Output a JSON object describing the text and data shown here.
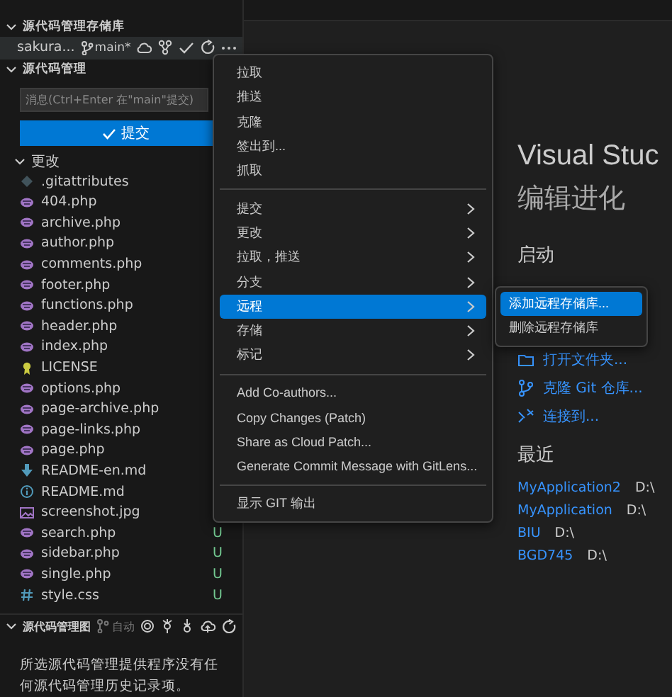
{
  "sidebar": {
    "repos_header": "源代码管理存储库",
    "repo": {
      "name": "sakura...",
      "branch": "main*"
    },
    "scm_header": "源代码管理",
    "message": {
      "placeholder": "消息(Ctrl+Enter 在\"main\"提交)"
    },
    "commit_button": "提交",
    "changes_header": "更改",
    "files": [
      {
        "name": ".gitattributes",
        "kind": "git"
      },
      {
        "name": "404.php",
        "kind": "php"
      },
      {
        "name": "archive.php",
        "kind": "php"
      },
      {
        "name": "author.php",
        "kind": "php"
      },
      {
        "name": "comments.php",
        "kind": "php"
      },
      {
        "name": "footer.php",
        "kind": "php"
      },
      {
        "name": "functions.php",
        "kind": "php"
      },
      {
        "name": "header.php",
        "kind": "php"
      },
      {
        "name": "index.php",
        "kind": "php"
      },
      {
        "name": "LICENSE",
        "kind": "license"
      },
      {
        "name": "options.php",
        "kind": "php"
      },
      {
        "name": "page-archive.php",
        "kind": "php"
      },
      {
        "name": "page-links.php",
        "kind": "php"
      },
      {
        "name": "page.php",
        "kind": "php"
      },
      {
        "name": "README-en.md",
        "kind": "mddown"
      },
      {
        "name": "README.md",
        "kind": "info"
      },
      {
        "name": "screenshot.jpg",
        "kind": "image"
      },
      {
        "name": "search.php",
        "kind": "php",
        "status": "U"
      },
      {
        "name": "sidebar.php",
        "kind": "php",
        "status": "U"
      },
      {
        "name": "single.php",
        "kind": "php",
        "status": "U"
      },
      {
        "name": "style.css",
        "kind": "css",
        "status": "U"
      }
    ],
    "graph_header": "源代码管理图",
    "graph_auto": "自动",
    "graph_message": "所选源代码管理提供程序没有任何源代码管理历史记录项。"
  },
  "welcome": {
    "title": "Visual Stuc",
    "subtitle": "编辑进化",
    "start_header": "启动",
    "start_items": [
      {
        "label": "打开文件夹...",
        "kind": "folder"
      },
      {
        "label": "克隆 Git 仓库...",
        "kind": "clone"
      },
      {
        "label": "连接到...",
        "kind": "remote"
      }
    ],
    "recent_header": "最近",
    "recent": [
      {
        "name": "MyApplication2",
        "path": "D:\\"
      },
      {
        "name": "MyApplication",
        "path": "D:\\"
      },
      {
        "name": "BIU",
        "path": "D:\\"
      },
      {
        "name": "BGD745",
        "path": "D:\\"
      }
    ]
  },
  "menu": {
    "groups": [
      [
        {
          "label": "拉取",
          "submenu": false,
          "selected": false
        },
        {
          "label": "推送",
          "submenu": false,
          "selected": false
        },
        {
          "label": "克隆",
          "submenu": false,
          "selected": false
        },
        {
          "label": "签出到...",
          "submenu": false,
          "selected": false
        },
        {
          "label": "抓取",
          "submenu": false,
          "selected": false
        }
      ],
      [
        {
          "label": "提交",
          "submenu": true,
          "selected": false
        },
        {
          "label": "更改",
          "submenu": true,
          "selected": false
        },
        {
          "label": "拉取，推送",
          "submenu": true,
          "selected": false
        },
        {
          "label": "分支",
          "submenu": true,
          "selected": false
        },
        {
          "label": "远程",
          "submenu": true,
          "selected": true
        },
        {
          "label": "存储",
          "submenu": true,
          "selected": false
        },
        {
          "label": "标记",
          "submenu": true,
          "selected": false
        }
      ],
      [
        {
          "label": "Add Co-authors...",
          "submenu": false,
          "selected": false
        },
        {
          "label": "Copy Changes (Patch)",
          "submenu": false,
          "selected": false
        },
        {
          "label": "Share as Cloud Patch...",
          "submenu": false,
          "selected": false
        },
        {
          "label": "Generate Commit Message with GitLens...",
          "submenu": false,
          "selected": false
        }
      ],
      [
        {
          "label": "显示 GIT 输出",
          "submenu": false,
          "selected": false
        }
      ]
    ]
  },
  "submenu": [
    {
      "label": "添加远程存储库...",
      "selected": true
    },
    {
      "label": "删除远程存储库",
      "selected": false
    }
  ]
}
